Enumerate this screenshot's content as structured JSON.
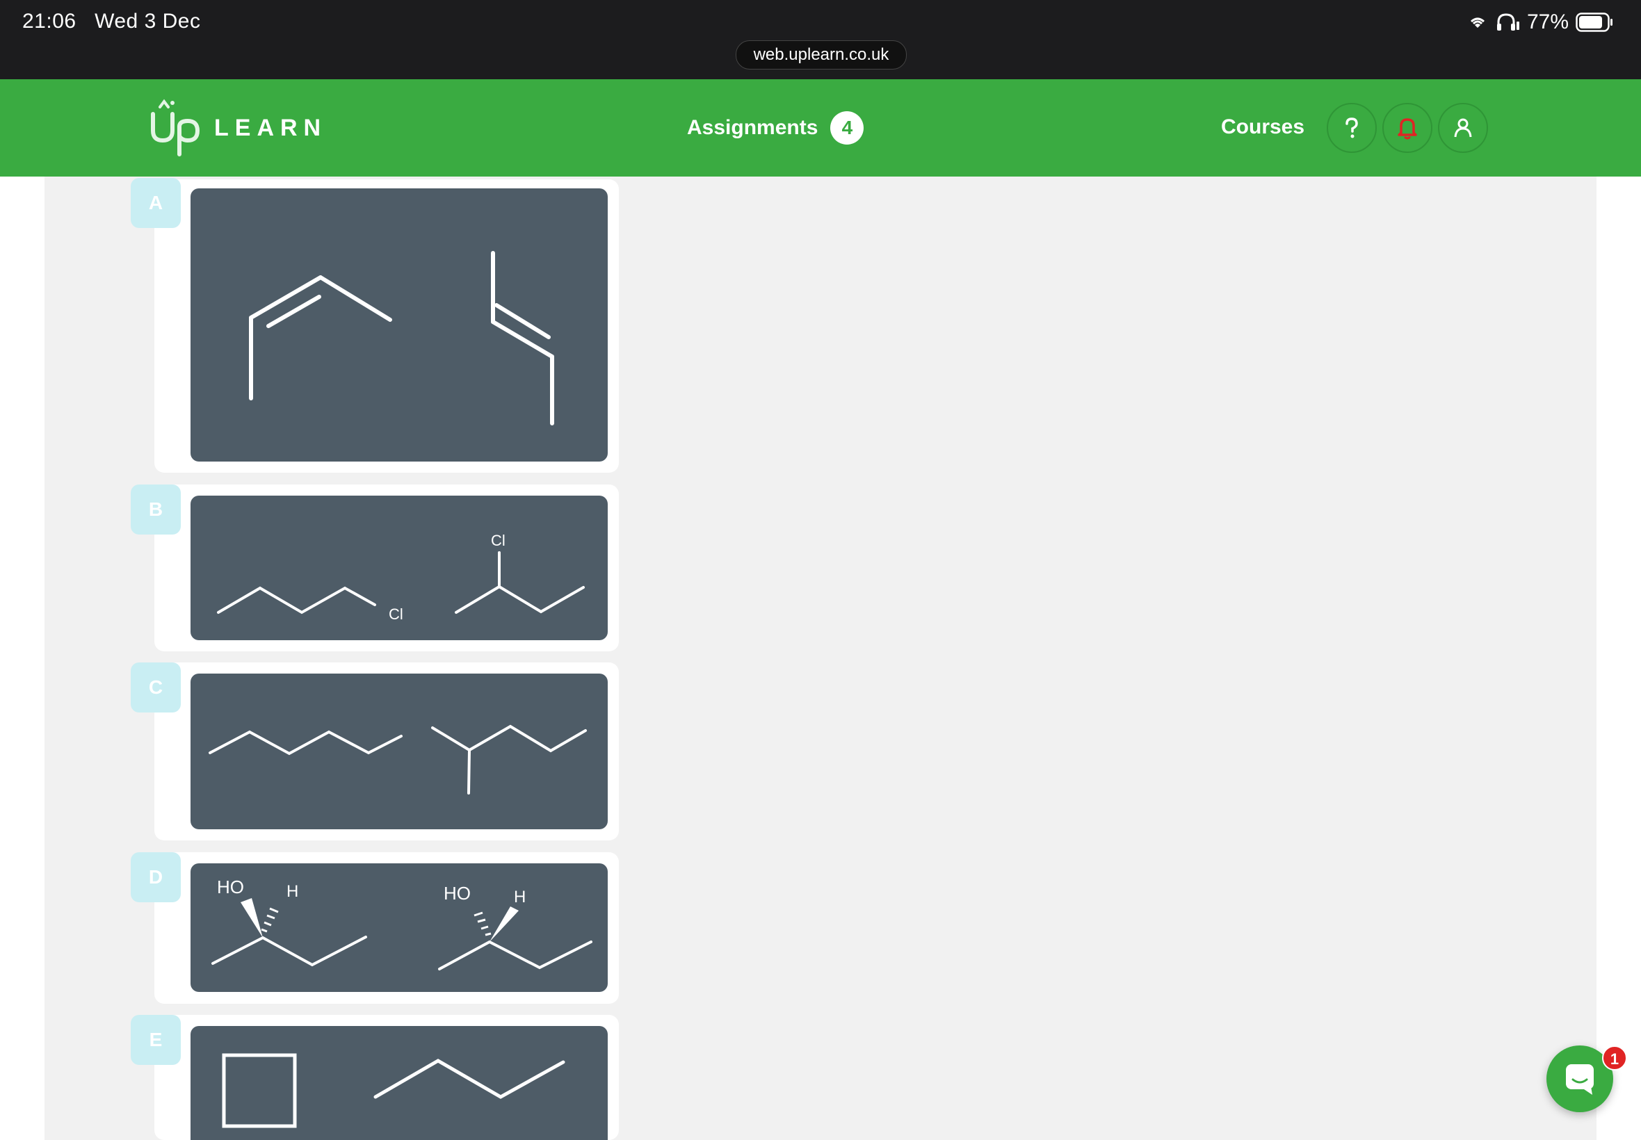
{
  "status_bar": {
    "time": "21:06",
    "date": "Wed 3 Dec",
    "battery": "77%",
    "url": "web.uplearn.co.uk"
  },
  "header": {
    "logo_text": "LEARN",
    "nav": {
      "assignments_label": "Assignments",
      "assignments_count": "4",
      "courses_label": "Courses"
    },
    "icons": [
      "help-icon",
      "bell-icon",
      "user-icon"
    ],
    "colors": {
      "brand_green": "#3aab41",
      "bell_red": "#e02424"
    }
  },
  "options": [
    {
      "letter": "A"
    },
    {
      "letter": "B",
      "labels": [
        "Cl",
        "Cl"
      ]
    },
    {
      "letter": "C"
    },
    {
      "letter": "D",
      "labels": [
        "HO",
        "H",
        "HO",
        "H"
      ]
    },
    {
      "letter": "E"
    }
  ],
  "chat": {
    "unread_count": "1"
  }
}
